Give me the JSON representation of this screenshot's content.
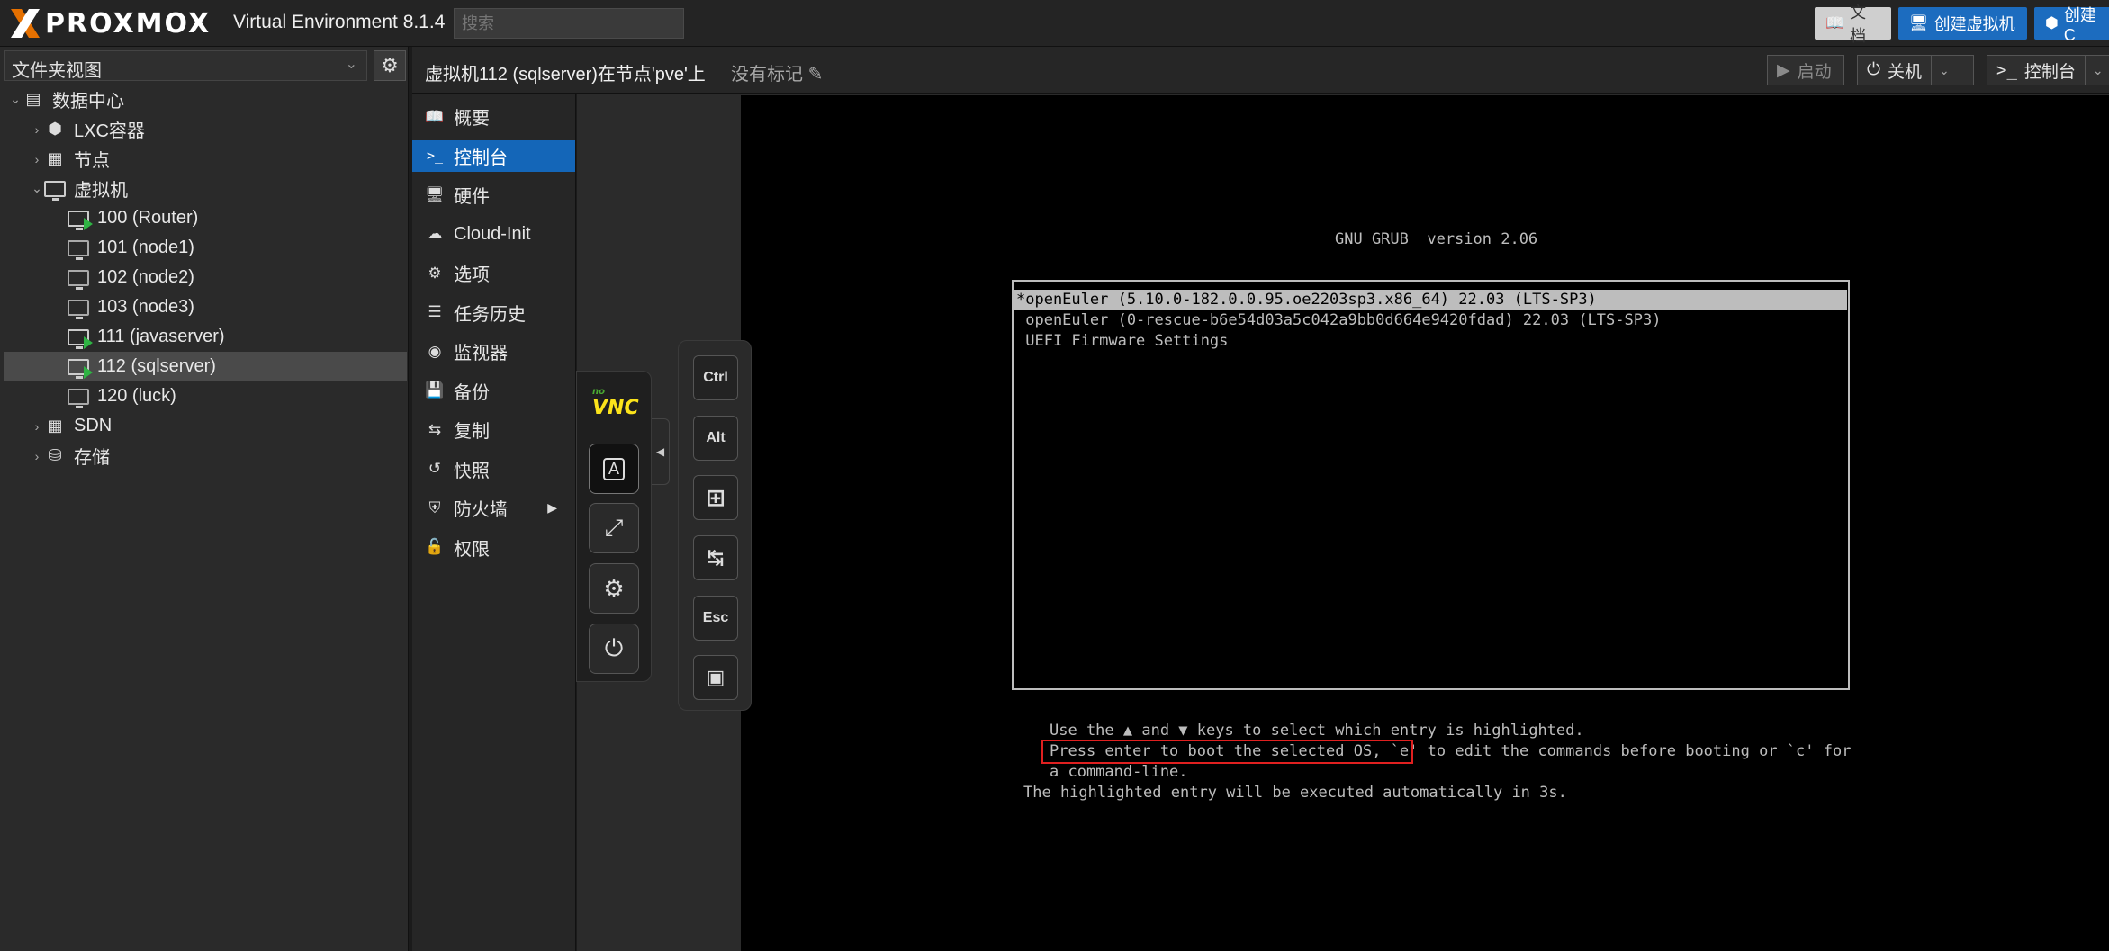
{
  "topbar": {
    "brand": "PROXMOX",
    "product": "Virtual Environment 8.1.4",
    "search_placeholder": "搜索",
    "docs_label": "文档",
    "create_vm_label": "创建虚拟机",
    "create_ct_label": "创建C"
  },
  "sidebar": {
    "view_label": "文件夹视图",
    "tree": {
      "root": "数据中心",
      "lxc": "LXC容器",
      "nodes": "节点",
      "vms": "虚拟机",
      "vm_items": [
        "100 (Router)",
        "101 (node1)",
        "102 (node2)",
        "103 (node3)",
        "111 (javaserver)",
        "112 (sqlserver)",
        "120 (luck)"
      ],
      "sdn": "SDN",
      "storage": "存储"
    }
  },
  "header": {
    "title": "虚拟机112 (sqlserver)在节点'pve'上",
    "tags": "没有标记",
    "start_label": "启动",
    "shutdown_label": "关机",
    "console_label": "控制台"
  },
  "nav": {
    "items": [
      "概要",
      "控制台",
      "硬件",
      "Cloud-Init",
      "选项",
      "任务历史",
      "监视器",
      "备份",
      "复制",
      "快照",
      "防火墙",
      "权限"
    ]
  },
  "vnc": {
    "logo_small": "no",
    "logo": "VNC",
    "keys": [
      "Ctrl",
      "Alt",
      "Esc"
    ]
  },
  "grub": {
    "title": "GNU GRUB  version 2.06",
    "entries": [
      "*openEuler (5.10.0-182.0.0.95.oe2203sp3.x86_64) 22.03 (LTS-SP3)",
      " openEuler (0-rescue-b6e54d03a5c042a9bb0d664e9420fdad) 22.03 (LTS-SP3)",
      " UEFI Firmware Settings"
    ],
    "help": [
      "Use the ▲ and ▼ keys to select which entry is highlighted.",
      "Press enter to boot the selected OS, `e' to edit the commands before booting or `c' for",
      "a command-line.",
      "The highlighted entry will be executed automatically in 3s."
    ]
  },
  "colors": {
    "accent": "#1466b8",
    "running": "#2fb344",
    "highlight_box": "#e02020",
    "logo_orange": "#e57000"
  }
}
